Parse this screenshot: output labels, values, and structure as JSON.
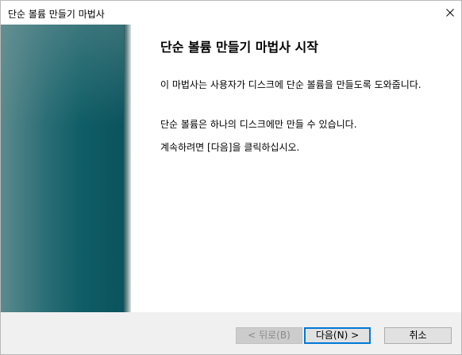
{
  "window": {
    "title": "단순 볼륨 만들기 마법사",
    "close_glyph": "✕"
  },
  "content": {
    "heading": "단순 볼륨 만들기 마법사 시작",
    "paragraph1": "이 마법사는 사용자가 디스크에 단순 볼륨을 만들도록 도와줍니다.",
    "paragraph2": "단순 볼륨은 하나의 디스크에만 만들 수 있습니다.",
    "paragraph3": "계속하려면 [다음]을 클릭하십시오."
  },
  "buttons": {
    "back_label": "< 뒤로(B)",
    "next_label": "다음(N) >",
    "cancel_label": "취소"
  },
  "colors": {
    "banner": "#0f5d66",
    "focus_border": "#0078d7",
    "disabled_text": "#8a8a8a"
  }
}
